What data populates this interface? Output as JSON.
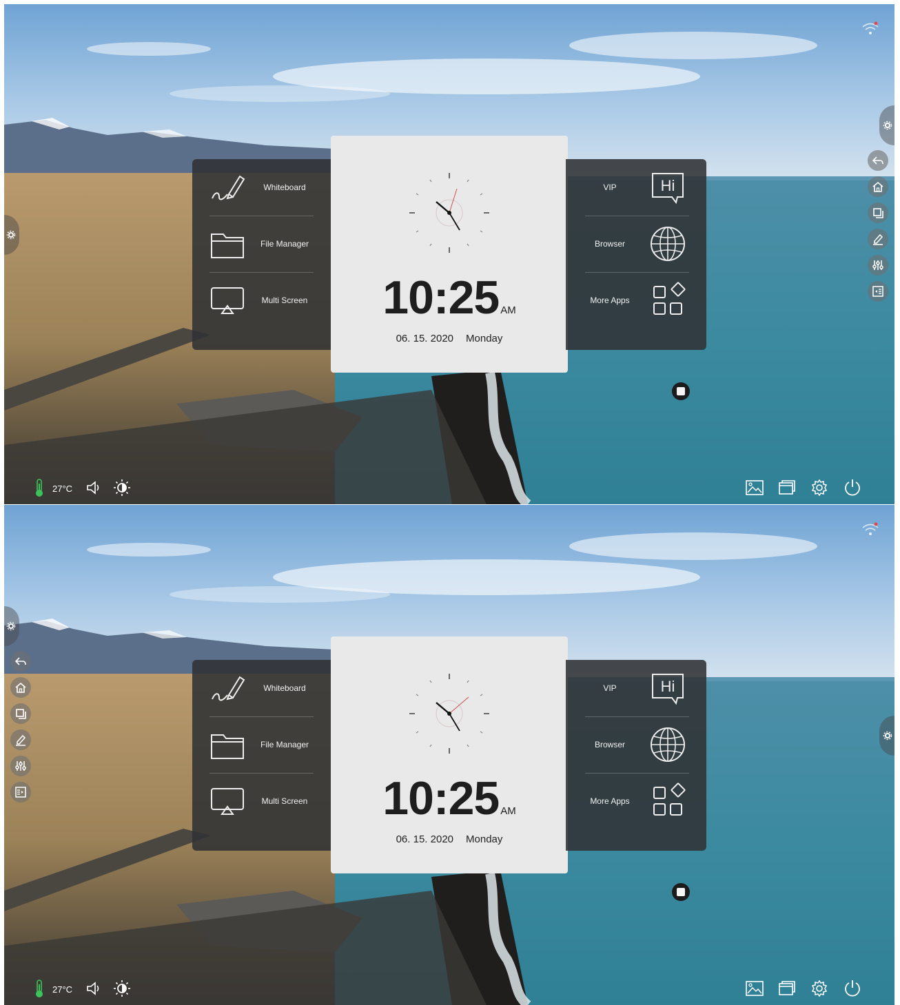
{
  "launcher": {
    "left_items": [
      {
        "label": "Whiteboard",
        "icon": "pen-icon"
      },
      {
        "label": "File Manager",
        "icon": "folder-icon"
      },
      {
        "label": "Multi Screen",
        "icon": "screen-cast-icon"
      }
    ],
    "right_items": [
      {
        "label": "VIP",
        "icon": "hi-speech-icon"
      },
      {
        "label": "Browser",
        "icon": "globe-icon"
      },
      {
        "label": "More Apps",
        "icon": "apps-grid-icon"
      }
    ],
    "clock": {
      "time": "10:25",
      "ampm": "AM",
      "date": "06. 15. 2020",
      "weekday": "Monday"
    }
  },
  "status": {
    "temperature": "27°C"
  },
  "sidebar_tools": [
    "back-icon",
    "home-icon",
    "windows-icon",
    "annotate-icon",
    "equalizer-icon",
    "apps-panel-icon"
  ],
  "bottom_icons": [
    "wallpaper-icon",
    "window-icon",
    "settings-icon",
    "power-icon"
  ],
  "colors": {
    "card_dark": "#303234",
    "clock_card": "#e9e9e9",
    "second_hand": "#d05050",
    "thermometer": "#3cc45a"
  }
}
